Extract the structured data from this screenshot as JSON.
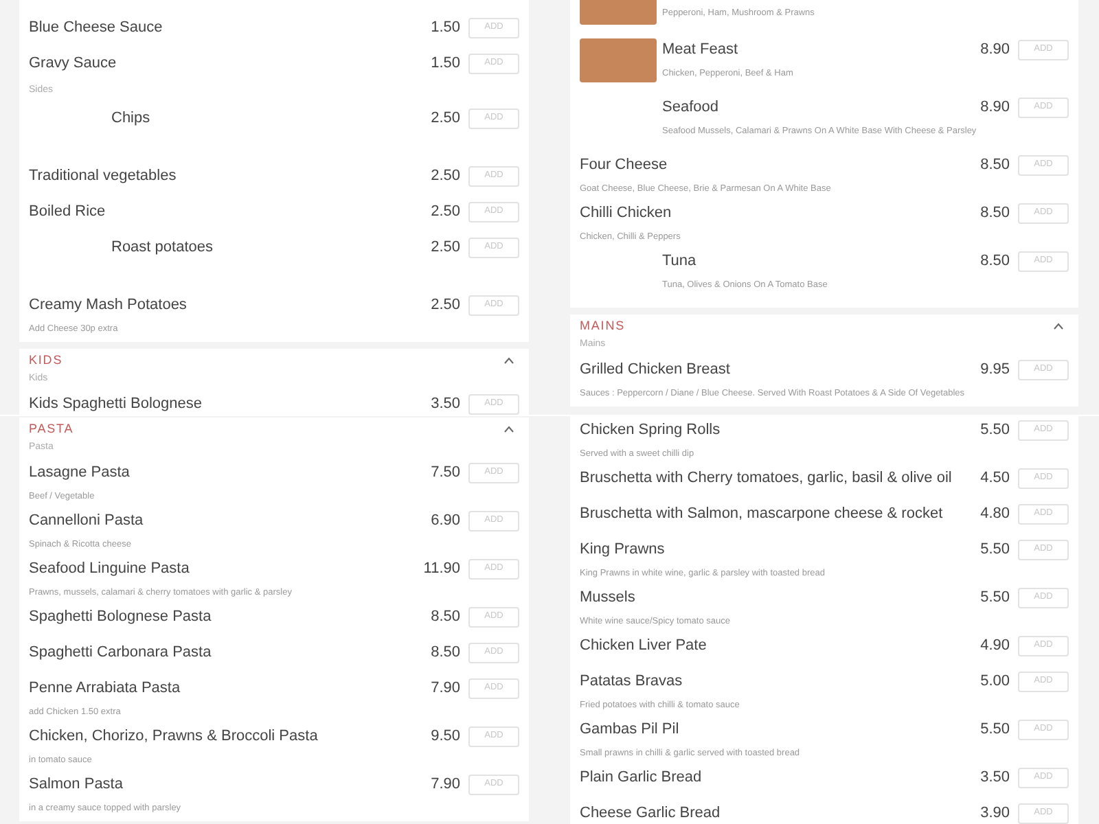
{
  "panes": [
    {
      "columns": [
        {
          "sections": [
            {
              "items": [
                {
                  "kind": "dish",
                  "name": "Blue Cheese Sauce",
                  "price": "1.50",
                  "button": "ADD"
                },
                {
                  "kind": "dish",
                  "name": "Gravy Sauce",
                  "price": "1.50",
                  "button": "ADD"
                },
                {
                  "kind": "subheading",
                  "name": "Sides"
                },
                {
                  "kind": "indented",
                  "name": "Chips",
                  "price": "2.50",
                  "button": "ADD"
                },
                {
                  "kind": "dish",
                  "name": "Traditional vegetables",
                  "price": "2.50",
                  "button": "ADD"
                },
                {
                  "kind": "dish",
                  "name": "Boiled Rice",
                  "price": "2.50",
                  "button": "ADD"
                },
                {
                  "kind": "indented",
                  "name": "Roast potatoes",
                  "price": "2.50",
                  "button": "ADD"
                },
                {
                  "kind": "dish",
                  "name": "Creamy Mash Potatoes",
                  "price": "2.50",
                  "button": "ADD",
                  "description": "Add Cheese 30p extra"
                }
              ]
            },
            {
              "title": "KIDS",
              "expanded": true,
              "subtitle": "Kids",
              "items": [
                {
                  "kind": "dish",
                  "name": "Kids Spaghetti Bolognese",
                  "price": "3.50",
                  "button": "ADD"
                }
              ]
            }
          ]
        },
        {
          "sections": [
            {
              "items": [
                {
                  "kind": "pictured",
                  "description": "Pepperoni, Ham, Mushroom & Prawns"
                },
                {
                  "kind": "pictured",
                  "name": "Meat Feast",
                  "price": "8.90",
                  "button": "ADD",
                  "description": "Chicken, Pepperoni, Beef & Ham"
                },
                {
                  "kind": "indented",
                  "name": "Seafood",
                  "price": "8.90",
                  "button": "ADD",
                  "description": "Seafood Mussels, Calamari & Prawns On A White Base With Cheese & Parsley"
                },
                {
                  "kind": "dish",
                  "name": "Four Cheese",
                  "price": "8.50",
                  "button": "ADD",
                  "description": "Goat Cheese, Blue Cheese, Brie & Parmesan On A White Base"
                },
                {
                  "kind": "dish",
                  "name": "Chilli Chicken",
                  "price": "8.50",
                  "button": "ADD",
                  "description": "Chicken, Chilli & Peppers"
                },
                {
                  "kind": "indented",
                  "name": "Tuna",
                  "price": "8.50",
                  "button": "ADD",
                  "description": "Tuna, Olives & Onions On A Tomato Base"
                }
              ]
            },
            {
              "title": "MAINS",
              "expanded": true,
              "subtitle": "Mains",
              "items": [
                {
                  "kind": "dish",
                  "name": "Grilled Chicken Breast",
                  "price": "9.95",
                  "button": "ADD",
                  "description": "Sauces : Peppercorn / Diane / Blue Cheese. Served With Roast Potatoes & A Side Of Vegetables"
                }
              ]
            }
          ]
        }
      ]
    },
    {
      "columns": [
        {
          "sections": [
            {
              "title": "PASTA",
              "expanded": true,
              "subtitle": "Pasta",
              "items": [
                {
                  "kind": "dish",
                  "name": "Lasagne Pasta",
                  "price": "7.50",
                  "button": "ADD",
                  "description": "Beef / Vegetable"
                },
                {
                  "kind": "dish",
                  "name": "Cannelloni Pasta",
                  "price": "6.90",
                  "button": "ADD",
                  "description": "Spinach & Ricotta cheese"
                },
                {
                  "kind": "dish",
                  "name": "Seafood Linguine Pasta",
                  "price": "11.90",
                  "button": "ADD",
                  "description": "Prawns, mussels, calamari & cherry tomatoes with garlic & parsley"
                },
                {
                  "kind": "dish",
                  "name": "Spaghetti Bolognese Pasta",
                  "price": "8.50",
                  "button": "ADD"
                },
                {
                  "kind": "dish",
                  "name": "Spaghetti Carbonara Pasta",
                  "price": "8.50",
                  "button": "ADD"
                },
                {
                  "kind": "dish",
                  "name": "Penne Arrabiata Pasta",
                  "price": "7.90",
                  "button": "ADD",
                  "description": "add Chicken 1.50 extra"
                },
                {
                  "kind": "dish",
                  "name": "Chicken, Chorizo, Prawns & Broccoli Pasta",
                  "price": "9.50",
                  "button": "ADD",
                  "description": "in tomato sauce"
                },
                {
                  "kind": "dish",
                  "name": "Salmon Pasta",
                  "price": "7.90",
                  "button": "ADD",
                  "description": "in a creamy sauce topped with parsley"
                }
              ]
            }
          ]
        },
        {
          "sections": [
            {
              "items": [
                {
                  "kind": "dish",
                  "name": "Chicken Spring Rolls",
                  "price": "5.50",
                  "button": "ADD",
                  "description": "Served with a sweet chilli dip"
                },
                {
                  "kind": "dish",
                  "name": "Bruschetta with Cherry tomatoes, garlic, basil & olive oil",
                  "price": "4.50",
                  "button": "ADD"
                },
                {
                  "kind": "dish",
                  "name": "Bruschetta with Salmon, mascarpone cheese & rocket",
                  "price": "4.80",
                  "button": "ADD"
                },
                {
                  "kind": "dish",
                  "name": "King Prawns",
                  "price": "5.50",
                  "button": "ADD",
                  "description": "King Prawns in white wine, garlic & parsley with toasted bread"
                },
                {
                  "kind": "dish",
                  "name": "Mussels",
                  "price": "5.50",
                  "button": "ADD",
                  "description": "White wine sauce/Spicy tomato sauce"
                },
                {
                  "kind": "dish",
                  "name": "Chicken Liver Pate",
                  "price": "4.90",
                  "button": "ADD"
                },
                {
                  "kind": "dish",
                  "name": "Patatas Bravas",
                  "price": "5.00",
                  "button": "ADD",
                  "description": "Fried potatoes with chilli & tomato sauce"
                },
                {
                  "kind": "dish",
                  "name": "Gambas Pil Pil",
                  "price": "5.50",
                  "button": "ADD",
                  "description": "Small prawns in chilli & garlic served with toasted bread"
                },
                {
                  "kind": "dish",
                  "name": "Plain Garlic Bread",
                  "price": "3.50",
                  "button": "ADD"
                },
                {
                  "kind": "dish",
                  "name": "Cheese Garlic Bread",
                  "price": "3.90",
                  "button": "ADD"
                }
              ]
            }
          ]
        }
      ]
    }
  ]
}
